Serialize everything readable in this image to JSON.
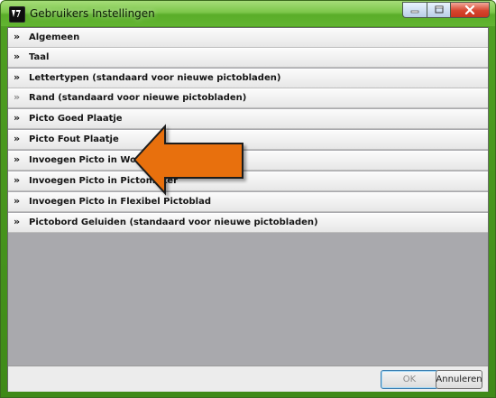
{
  "window": {
    "title": "Gebruikers Instellingen",
    "icon": "app-icon",
    "controls": [
      "minimize-icon",
      "maximize-icon",
      "close-icon"
    ]
  },
  "sections": [
    {
      "label": "Algemeen"
    },
    {
      "label": "Taal"
    },
    {
      "label": "Lettertypen (standaard voor nieuwe pictobladen)"
    },
    {
      "label": "Rand (standaard voor nieuwe pictobladen)"
    },
    {
      "label": "Picto Goed Plaatje"
    },
    {
      "label": "Picto Fout Plaatje"
    },
    {
      "label": "Invoegen Picto in Word"
    },
    {
      "label": "Invoegen Picto in Pictomaker"
    },
    {
      "label": "Invoegen Picto in Flexibel Pictoblad"
    },
    {
      "label": "Pictobord Geluiden (standaard voor nieuwe pictobladen)"
    }
  ],
  "chevron": "»",
  "footer": {
    "ok_label": "OK",
    "cancel_label": "Annuleren"
  },
  "annotation": {
    "icon": "arrow-left-icon",
    "color": "#e8700f",
    "points_to": "Invoegen Picto in Word"
  }
}
